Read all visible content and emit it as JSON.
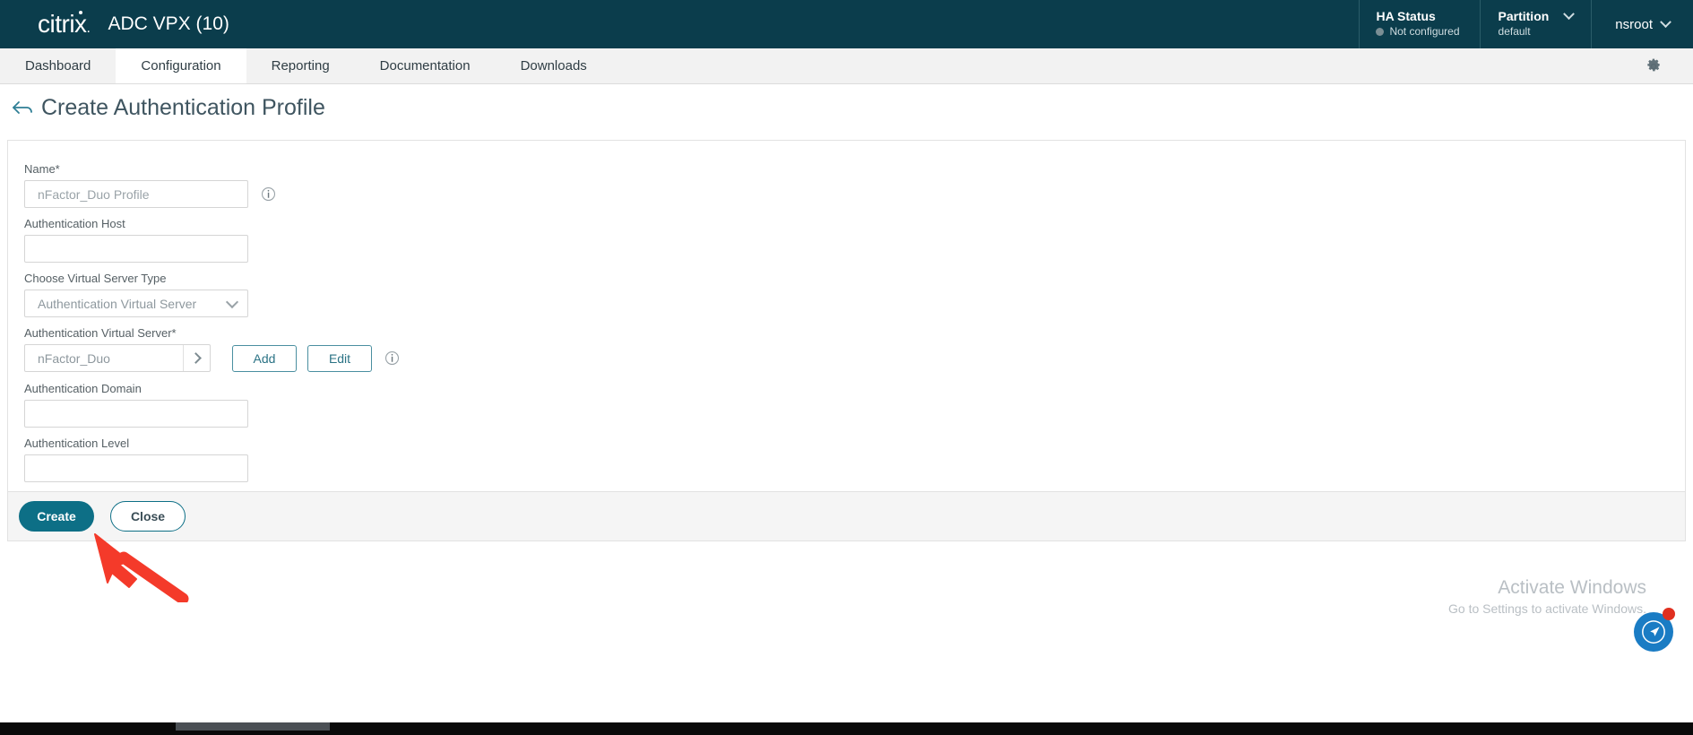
{
  "header": {
    "brand": "citrix",
    "brand_trail": ".",
    "app_title": "ADC VPX (10)",
    "ha_status_title": "HA Status",
    "ha_status_value": "Not configured",
    "partition_title": "Partition",
    "partition_value": "default",
    "user": "nsroot",
    "brand_bg": "#0b3d4c"
  },
  "tabs": [
    {
      "label": "Dashboard",
      "active": false
    },
    {
      "label": "Configuration",
      "active": true
    },
    {
      "label": "Reporting",
      "active": false
    },
    {
      "label": "Documentation",
      "active": false
    },
    {
      "label": "Downloads",
      "active": false
    }
  ],
  "tabbar": {
    "settings_icon": "gear-icon"
  },
  "page": {
    "back_icon": "back-arrow-icon",
    "title": "Create Authentication Profile"
  },
  "form": {
    "fields": [
      {
        "label": "Name*",
        "value": "",
        "placeholder": "nFactor_Duo Profile",
        "has_info": true
      },
      {
        "label": "Authentication Host",
        "value": "",
        "placeholder": "",
        "has_info": false
      }
    ],
    "server_type": {
      "label": "Choose Virtual Server Type",
      "selected": "Authentication Virtual Server"
    },
    "virtual_server": {
      "label": "Authentication Virtual Server*",
      "value": "nFactor_Duo",
      "add_label": "Add",
      "edit_label": "Edit",
      "has_info": true
    },
    "lower_fields": [
      {
        "label": "Authentication Domain",
        "value": "",
        "placeholder": ""
      },
      {
        "label": "Authentication Level",
        "value": "",
        "placeholder": ""
      }
    ]
  },
  "actions": {
    "create_label": "Create",
    "close_label": "Close",
    "primary_color": "#0d6f86"
  },
  "watermark": {
    "title": "Activate Windows",
    "subtitle": "Go to Settings to activate Windows."
  },
  "fab": {
    "icon": "navigation-arrow-icon",
    "color": "#1a7cc4",
    "badge_color": "#e03020"
  },
  "annotation": {
    "arrow_color": "#f43a2a"
  }
}
